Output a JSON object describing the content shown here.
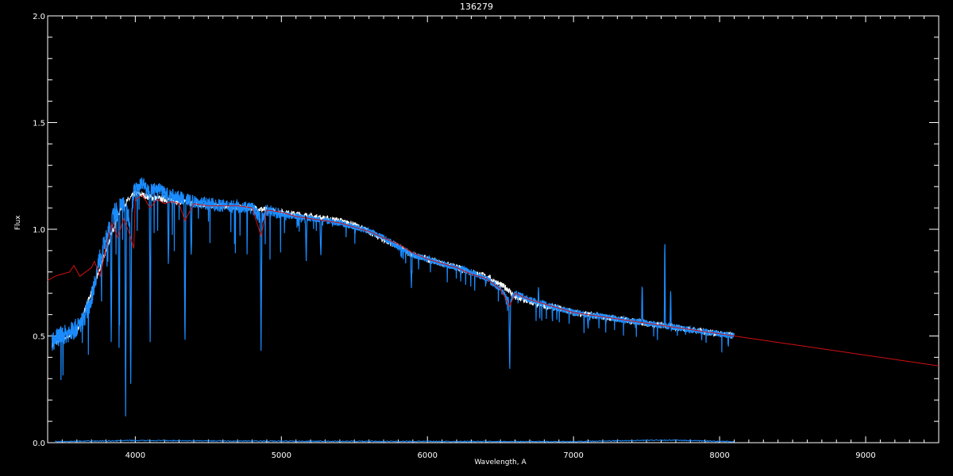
{
  "chart_data": {
    "type": "line",
    "title": "136279",
    "xlabel": "Wavelength, A",
    "ylabel": "Flux",
    "xlim": [
      3400,
      9500
    ],
    "ylim": [
      0.0,
      2.0
    ],
    "xticks": [
      4000,
      5000,
      6000,
      7000,
      8000,
      9000
    ],
    "yticks": [
      0.0,
      0.5,
      1.0,
      1.5,
      2.0
    ],
    "ytick_labels": [
      "0.0",
      "0.5",
      "1.0",
      "1.5",
      "2.0"
    ],
    "grid": false,
    "colors": {
      "background": "#000000",
      "axes": "#ffffff",
      "observed": "#1a8cff",
      "model": "#d01010",
      "white_series": "#ffffff"
    },
    "series": [
      {
        "key": "white",
        "x": [
          3430,
          3600,
          3750,
          3900,
          4000,
          4100,
          4200,
          4400,
          4600,
          4800,
          4900,
          5000,
          5200,
          5400,
          5500,
          5600,
          5700,
          5800,
          5900,
          6000,
          6100,
          6200,
          6300,
          6400,
          6500,
          6550,
          6600,
          6700,
          6800,
          6900,
          7000,
          7100,
          7200,
          7300,
          7400,
          7500,
          7600,
          7700,
          7800,
          7900,
          8000,
          8100
        ],
        "y": [
          0.46,
          0.52,
          0.8,
          1.1,
          1.17,
          1.15,
          1.14,
          1.12,
          1.11,
          1.1,
          1.09,
          1.08,
          1.06,
          1.04,
          1.02,
          0.99,
          0.95,
          0.92,
          0.88,
          0.86,
          0.84,
          0.82,
          0.8,
          0.78,
          0.74,
          0.72,
          0.68,
          0.66,
          0.64,
          0.63,
          0.61,
          0.6,
          0.59,
          0.58,
          0.57,
          0.56,
          0.55,
          0.54,
          0.53,
          0.52,
          0.51,
          0.5
        ]
      },
      {
        "key": "observed",
        "x": [
          3430,
          3480,
          3530,
          3580,
          3620,
          3660,
          3700,
          3730,
          3760,
          3800,
          3830,
          3860,
          3890,
          3920,
          3960,
          4000,
          4050,
          4100,
          4150,
          4200,
          4300,
          4400,
          4500,
          4600,
          4700,
          4800,
          4860,
          4900,
          4950,
          5000,
          5100,
          5200,
          5300,
          5400,
          5500,
          5600,
          5700,
          5800,
          5900,
          6000,
          6100,
          6200,
          6300,
          6400,
          6500,
          6563,
          6600,
          6700,
          6800,
          6900,
          7000,
          7100,
          7200,
          7300,
          7400,
          7500,
          7600,
          7700,
          7800,
          7900,
          8000,
          8100
        ],
        "y": [
          0.47,
          0.5,
          0.51,
          0.53,
          0.55,
          0.6,
          0.68,
          0.78,
          0.88,
          0.95,
          1.02,
          1.08,
          1.1,
          1.12,
          1.05,
          1.2,
          1.22,
          1.18,
          1.2,
          1.17,
          1.15,
          1.13,
          1.12,
          1.11,
          1.11,
          1.1,
          1.05,
          1.09,
          1.08,
          1.07,
          1.06,
          1.05,
          1.04,
          1.03,
          1.01,
          0.99,
          0.96,
          0.92,
          0.88,
          0.86,
          0.84,
          0.82,
          0.8,
          0.77,
          0.72,
          0.66,
          0.7,
          0.67,
          0.65,
          0.63,
          0.61,
          0.6,
          0.59,
          0.58,
          0.57,
          0.56,
          0.55,
          0.54,
          0.53,
          0.52,
          0.51,
          0.5
        ],
        "absorption_lines": [
          {
            "x": 3835,
            "depth": 0.55
          },
          {
            "x": 3889,
            "depth": 0.62
          },
          {
            "x": 3934,
            "depth": 0.95
          },
          {
            "x": 3969,
            "depth": 0.9
          },
          {
            "x": 4102,
            "depth": 0.72
          },
          {
            "x": 4227,
            "depth": 0.35
          },
          {
            "x": 4340,
            "depth": 0.75
          },
          {
            "x": 4383,
            "depth": 0.3
          },
          {
            "x": 4861,
            "depth": 0.65
          },
          {
            "x": 5170,
            "depth": 0.2
          },
          {
            "x": 5270,
            "depth": 0.18
          },
          {
            "x": 5890,
            "depth": 0.15
          },
          {
            "x": 6563,
            "depth": 0.33
          },
          {
            "x": 7100,
            "depth": 0.08
          }
        ],
        "emission_lines": [
          {
            "x": 6760,
            "height": 0.06
          },
          {
            "x": 7470,
            "height": 0.2
          },
          {
            "x": 7625,
            "height": 0.45
          },
          {
            "x": 7665,
            "height": 0.2
          }
        ]
      },
      {
        "key": "model",
        "x": [
          3400,
          3450,
          3500,
          3550,
          3580,
          3620,
          3660,
          3700,
          3720,
          3760,
          3800,
          3840,
          3880,
          3920,
          3960,
          3990,
          4000,
          4050,
          4100,
          4150,
          4200,
          4250,
          4300,
          4340,
          4400,
          4500,
          4600,
          4700,
          4800,
          4861,
          4900,
          5000,
          5100,
          5200,
          5300,
          5400,
          5500,
          5600,
          5700,
          5800,
          5900,
          6000,
          6100,
          6200,
          6300,
          6400,
          6500,
          6563,
          6600,
          6700,
          6800,
          6900,
          7000,
          7100,
          7200,
          7300,
          7400,
          7500,
          7600,
          7700,
          7800,
          7900,
          8000,
          8100,
          8200,
          8300,
          8400,
          8500,
          8600,
          8700,
          8800,
          8900,
          9000,
          9100,
          9200,
          9300,
          9400,
          9500
        ],
        "y": [
          0.76,
          0.78,
          0.79,
          0.8,
          0.83,
          0.78,
          0.8,
          0.82,
          0.85,
          0.78,
          0.92,
          1.03,
          0.96,
          1.05,
          0.98,
          0.91,
          1.14,
          1.16,
          1.1,
          1.14,
          1.12,
          1.13,
          1.12,
          1.04,
          1.12,
          1.11,
          1.11,
          1.11,
          1.1,
          0.97,
          1.09,
          1.08,
          1.06,
          1.05,
          1.04,
          1.03,
          1.01,
          0.99,
          0.96,
          0.93,
          0.89,
          0.86,
          0.84,
          0.82,
          0.79,
          0.77,
          0.72,
          0.64,
          0.7,
          0.67,
          0.65,
          0.63,
          0.61,
          0.6,
          0.59,
          0.58,
          0.57,
          0.56,
          0.55,
          0.54,
          0.53,
          0.52,
          0.51,
          0.5,
          0.49,
          0.48,
          0.47,
          0.46,
          0.45,
          0.44,
          0.43,
          0.42,
          0.41,
          0.4,
          0.39,
          0.38,
          0.37,
          0.36
        ]
      },
      {
        "key": "residual",
        "x": [
          3450,
          4000,
          5000,
          6000,
          7000,
          7600,
          8100
        ],
        "y": [
          0.005,
          0.01,
          0.007,
          0.006,
          0.005,
          0.012,
          0.005
        ]
      }
    ]
  }
}
